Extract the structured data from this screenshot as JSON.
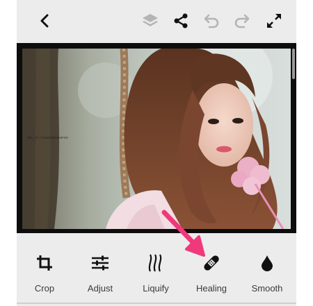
{
  "toolbar": {
    "back_icon": "chevron-left-icon",
    "layers_icon": "layers-icon",
    "share_icon": "share-icon",
    "undo_icon": "undo-icon",
    "redo_icon": "redo-icon",
    "fullscreen_icon": "expand-icon"
  },
  "canvas": {
    "watermark": "PH_AT / PHOTOGRAPHY"
  },
  "tools": [
    {
      "label": "Crop",
      "icon": "crop-icon"
    },
    {
      "label": "Adjust",
      "icon": "sliders-icon"
    },
    {
      "label": "Liquify",
      "icon": "liquify-icon"
    },
    {
      "label": "Healing",
      "icon": "bandage-icon"
    },
    {
      "label": "Smooth",
      "icon": "drop-icon"
    }
  ],
  "colors": {
    "toolbar_bg": "#ececec",
    "icon_active": "#111111",
    "icon_disabled": "#b4b4b4",
    "highlight_arrow": "#f0397a"
  }
}
